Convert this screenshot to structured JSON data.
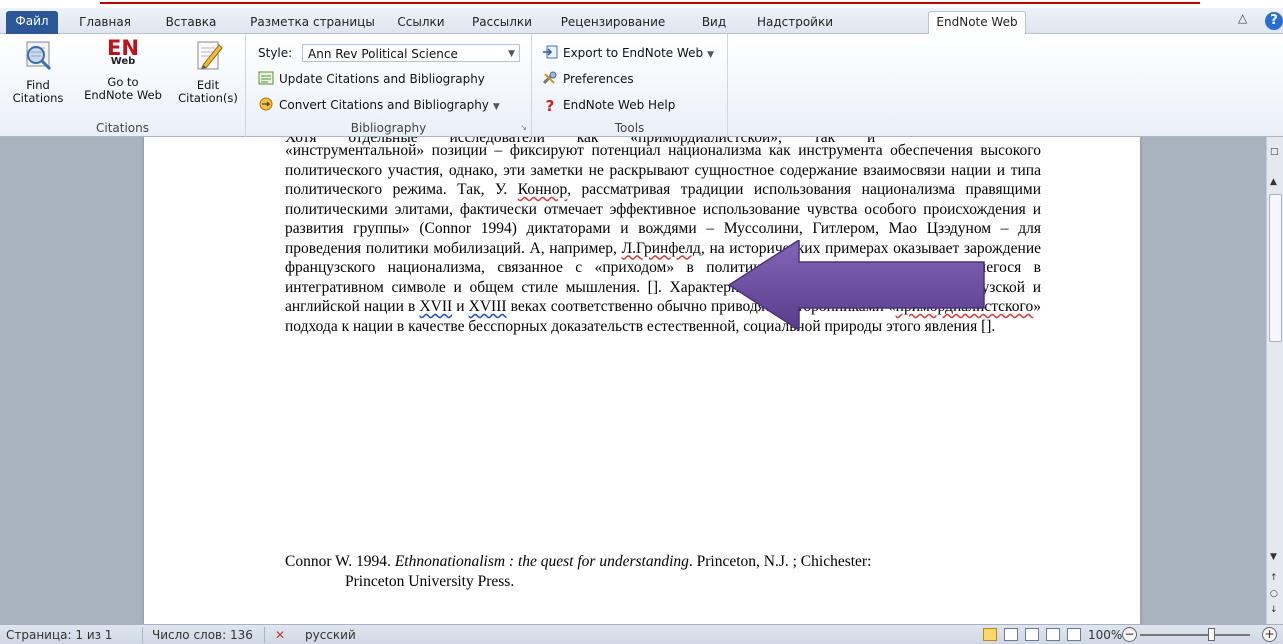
{
  "tabs": {
    "file": "Файл",
    "items": [
      "Главная",
      "Вставка",
      "Разметка страницы",
      "Ссылки",
      "Рассылки",
      "Рецензирование",
      "Вид",
      "Надстройки"
    ],
    "active": "EndNote Web"
  },
  "ribbon": {
    "citations": {
      "find": "Find\nCitations",
      "goto_top": "Go to",
      "goto_bottom": "EndNote Web",
      "edit_top": "Edit",
      "edit_bottom": "Citation(s)",
      "logo_main": "EN",
      "logo_sub": "Web",
      "group_label": "Citations"
    },
    "bibliography": {
      "style_label": "Style:",
      "style_value": "Ann Rev Political Science",
      "update": "Update Citations and Bibliography",
      "convert": "Convert Citations and Bibliography",
      "group_label": "Bibliography"
    },
    "tools": {
      "export": "Export to EndNote Web",
      "preferences": "Preferences",
      "help": "EndNote Web Help",
      "group_label": "Tools"
    }
  },
  "document": {
    "top_fragment": "Хотя отдельные исследователи как «примордиалистской», так и",
    "paragraph_parts": {
      "p1": "«инструментальной» позиции – фиксируют потенциал национализма как инструмента обеспечения высокого политического участия, однако, эти заметки не раскрывают сущностное содержание взаимосвязи нации и типа политического режима. Так, У. ",
      "connor": "Коннор",
      "p2": ", рассматривая традиции использования национализма правящими политическими элитами, фактически отмечает эффективное использование чувства особого происхождения и развития группы» (Connor 1994) диктаторами и вождями – Муссолини, Гитлером, Мао Цзэдуном – для проведения политики мобилизаций. А, например, ",
      "greenfeld": "Л.Гринфелд",
      "p3": ", на исторических примерах оказывает зарождение французского национализма, связанное с «приходом» в политику третьего сословия, нуждавшегося в интегративном символе и общем стиле мышления. []. Характерно, что примеры зарождения французской и английской нации в ",
      "c17": "XVII",
      "p4": " и ",
      "c18": "XVIII",
      "p5": " веках соответственно обычно приводятся сторонниками «",
      "primord": "примордиалистского",
      "p6": "» подхода к нации в качестве бесспорных доказательств естественной, социальной природы этого явления []."
    },
    "bibliography": {
      "line1_a": "Connor W. 1994. ",
      "line1_title": "Ethnonationalism : the quest for understanding",
      "line1_b": ". Princeton, N.J. ; Chichester:",
      "line2": "Princeton University Press."
    }
  },
  "status_bar": {
    "page": "Страница: 1 из 1",
    "words": "Число слов: 136",
    "language": "русский",
    "zoom": "100%"
  },
  "colors": {
    "file_tab": "#2b5797",
    "arrow": "#6b4a9a",
    "spell_underline": "#d04040"
  }
}
